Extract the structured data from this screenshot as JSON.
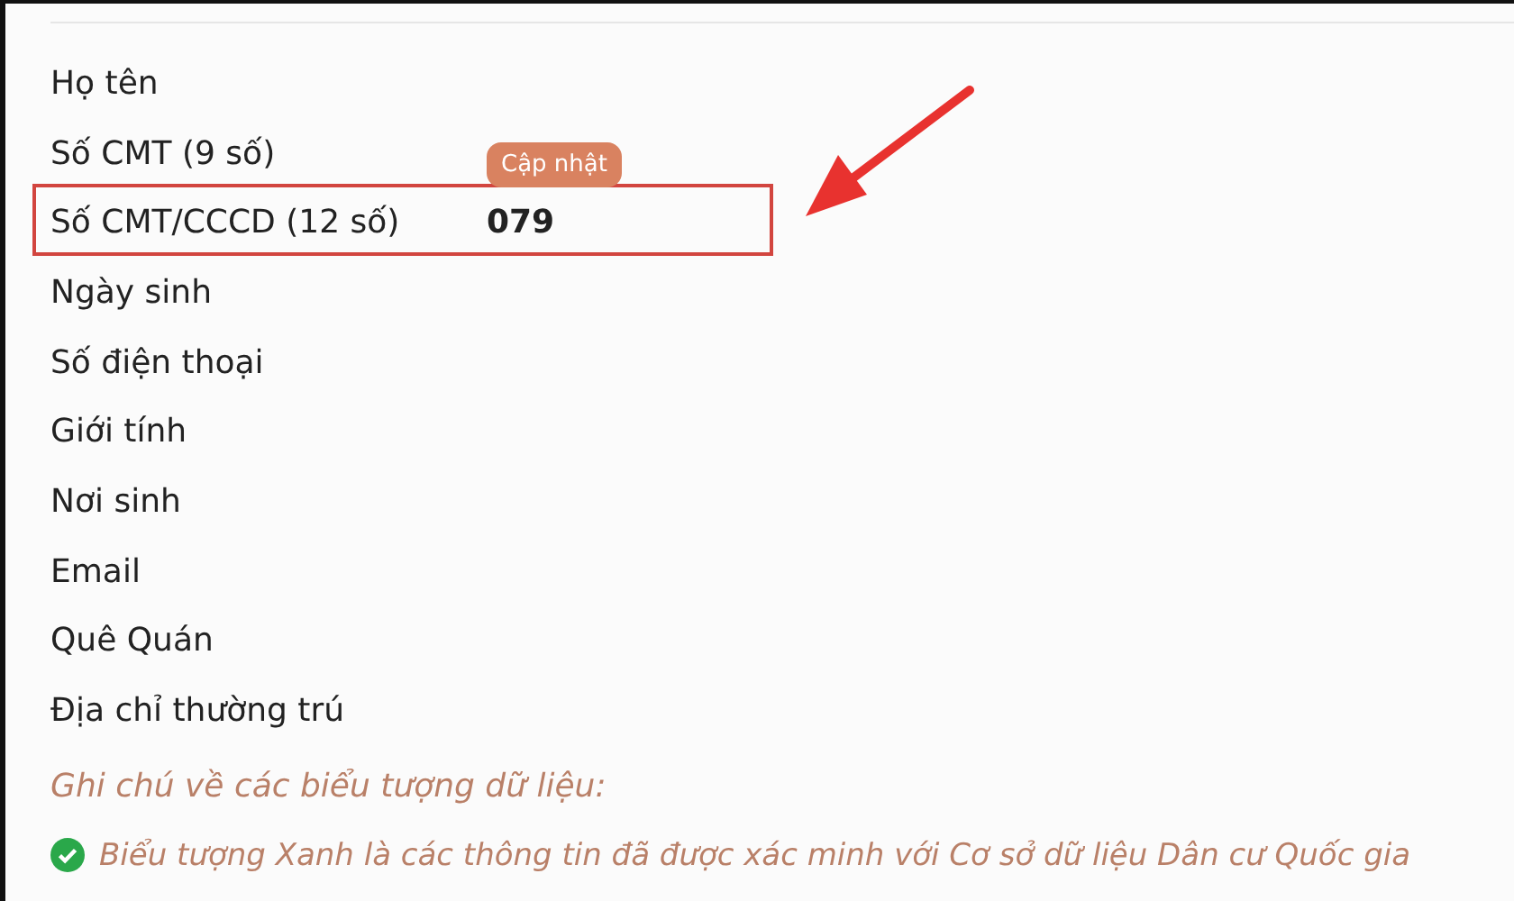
{
  "fields": [
    {
      "label": "Họ tên",
      "highlighted": false
    },
    {
      "label": "Số CMT (9 số)",
      "highlighted": false
    },
    {
      "label": "Số CMT/CCCD (12 số)",
      "value": "079",
      "tooltip": "Cập nhật",
      "highlighted": true
    },
    {
      "label": "Ngày sinh",
      "highlighted": false
    },
    {
      "label": "Số điện thoại",
      "highlighted": false
    },
    {
      "label": "Giới tính",
      "highlighted": false
    },
    {
      "label": "Nơi sinh",
      "highlighted": false
    },
    {
      "label": "Email",
      "highlighted": false
    },
    {
      "label": "Quê Quán",
      "highlighted": false
    },
    {
      "label": "Địa chỉ thường trú",
      "highlighted": false
    }
  ],
  "legend": {
    "title": "Ghi chú về các biểu tượng dữ liệu:",
    "items": [
      {
        "kind": "verified",
        "text": "Biểu tượng Xanh là các thông tin đã được xác minh với Cơ sở dữ liệu Dân cư Quốc gia"
      }
    ]
  }
}
